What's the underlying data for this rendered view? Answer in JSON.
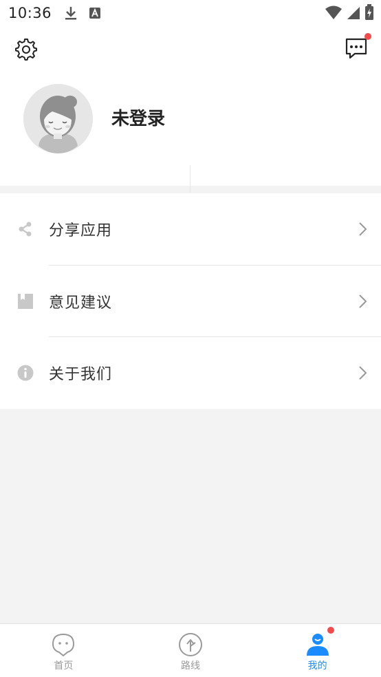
{
  "status_bar": {
    "time": "10:36",
    "left_icons": [
      "download-icon",
      "a-notification-icon"
    ],
    "right_icons": [
      "wifi-icon",
      "signal-icon",
      "battery-icon"
    ]
  },
  "header": {
    "settings_icon": "gear-icon",
    "message_icon": "chat-dots-icon",
    "message_badge": true
  },
  "profile": {
    "avatar_icon": "default-avatar",
    "name": "未登录"
  },
  "menu": {
    "items": [
      {
        "label": "分享应用",
        "icon": "share-icon"
      },
      {
        "label": "意见建议",
        "icon": "feedback-book-icon"
      },
      {
        "label": "关于我们",
        "icon": "info-icon"
      }
    ]
  },
  "tabs": [
    {
      "label": "首页",
      "icon": "home-pin-icon",
      "active": false
    },
    {
      "label": "路线",
      "icon": "route-icon",
      "active": false
    },
    {
      "label": "我的",
      "icon": "user-icon",
      "active": true,
      "badge": true
    }
  ],
  "colors": {
    "accent": "#1a8cff",
    "badge": "#f24b4b",
    "background": "#f3f3f3",
    "icon_gray": "#c8c8c8"
  }
}
